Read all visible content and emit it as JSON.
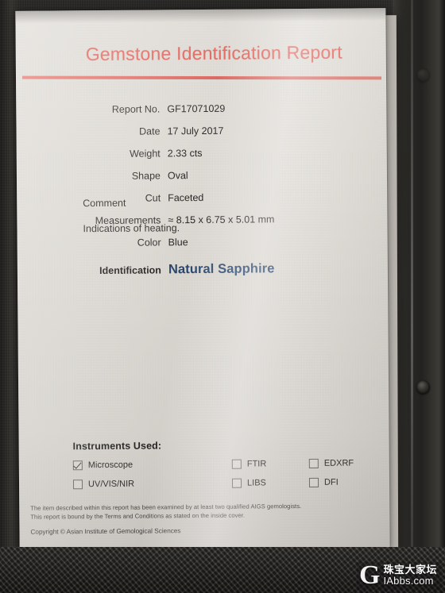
{
  "document": {
    "title": "Gemstone Identification Report",
    "accent_color": "#df5a50",
    "identification_color": "#24416b",
    "paper_color": "#dedad4"
  },
  "fields": [
    {
      "label": "Report No.",
      "value": "GF17071029"
    },
    {
      "label": "Date",
      "value": "17 July 2017"
    },
    {
      "label": "Weight",
      "value": "2.33 cts"
    },
    {
      "label": "Shape",
      "value": "Oval"
    },
    {
      "label": "Cut",
      "value": "Faceted"
    },
    {
      "label": "Measurements",
      "value": "≈ 8.15 x 6.75 x 5.01 mm"
    },
    {
      "label": "Color",
      "value": "Blue"
    }
  ],
  "identification": {
    "label": "Identification",
    "value": "Natural Sapphire"
  },
  "comment": {
    "label": "Comment",
    "text": "Indications of heating."
  },
  "instruments": {
    "title": "Instruments Used:",
    "items": [
      {
        "label": "Microscope",
        "checked": true
      },
      {
        "label": "FTIR",
        "checked": false
      },
      {
        "label": "EDXRF",
        "checked": false
      },
      {
        "label": "UV/VIS/NIR",
        "checked": false
      },
      {
        "label": "LIBS",
        "checked": false
      },
      {
        "label": "DFI",
        "checked": false
      }
    ]
  },
  "footer": {
    "line1": "The item described within this report has been examined by at least two qualified AIGS gemologists.",
    "line2": "This report is bound by the Terms and Conditions as stated on the inside cover.",
    "copyright": "Copyright © Asian Institute of Gemological Sciences"
  },
  "watermark": {
    "logo_letter": "G",
    "chinese": "珠宝大家坛",
    "domain": "IAbbs.com"
  }
}
